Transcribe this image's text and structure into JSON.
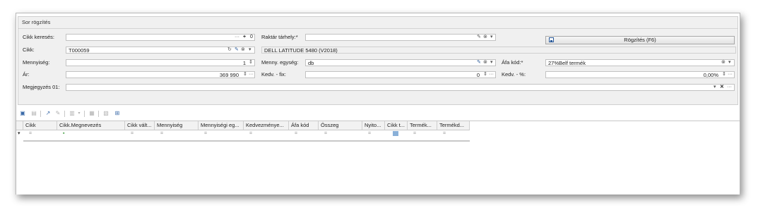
{
  "group_title": "Sor rögzítés",
  "fields": {
    "cikk_kereses": {
      "label": "Cikk keresés:",
      "value": "",
      "suffix": "0"
    },
    "cikk": {
      "label": "Cikk:",
      "value": "T000059",
      "description": "DELL LATITUDE 5480 (V2018)"
    },
    "mennyiseg": {
      "label": "Mennyiség:",
      "value": "1"
    },
    "ar": {
      "label": "Ár:",
      "value": "369 990"
    },
    "megjegyzes": {
      "label": "Megjegyzés 01:",
      "value": ""
    },
    "raktar": {
      "label": "Raktár tárhely:*",
      "value": ""
    },
    "menny_egyseg": {
      "label": "Menny. egység:",
      "value": "db"
    },
    "kedv_fix": {
      "label": "Kedv. - fix:",
      "value": "0"
    },
    "afa_kod": {
      "label": "Áfa kód:*",
      "value": "27%Belf termék"
    },
    "kedv_pct": {
      "label": "Kedv. - %:",
      "value": "0,00%"
    }
  },
  "save_button": {
    "label": "Rögzítés (F6)"
  },
  "grid": {
    "columns": [
      "Cikk",
      "Cikk.Megnevezés",
      "Cikk vált...",
      "Mennyiség",
      "Mennyiségi eg...",
      "Kedvezménye...",
      "Áfa kód",
      "Összeg",
      "Nyito...",
      "Cikk t...",
      "Termék...",
      "Termékd..."
    ],
    "filter_symbol": "="
  },
  "icons": {
    "dots": "···",
    "plus": "+",
    "spin": "⇕",
    "dropdown": "▾",
    "clear": "⊗",
    "edit": "✎",
    "refresh": "↻",
    "close": "✕"
  }
}
